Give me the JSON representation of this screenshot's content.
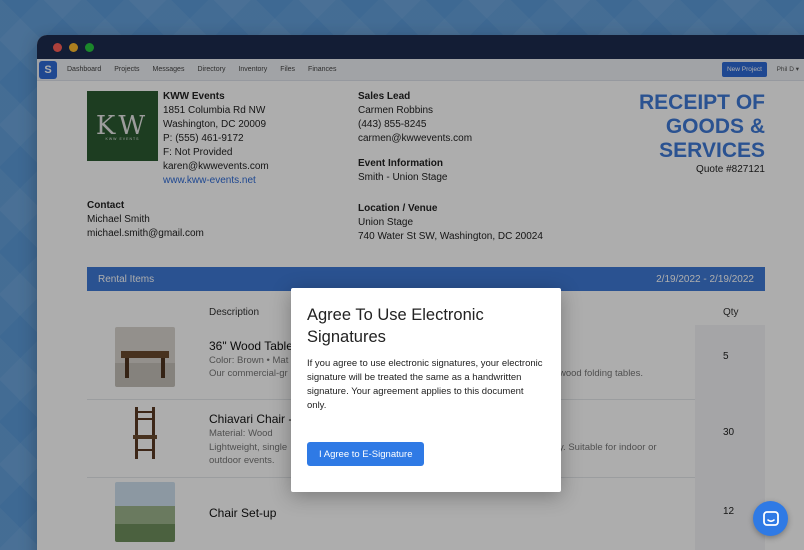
{
  "nav": {
    "logo_letter": "S",
    "items": [
      "Dashboard",
      "Projects",
      "Messages",
      "Directory",
      "Inventory",
      "Files",
      "Finances"
    ],
    "new_project": "New Project",
    "user": "Phil D ▾"
  },
  "company": {
    "logo_text": "KW",
    "logo_sub": "KWW EVENTS",
    "name": "KWW Events",
    "address1": "1851 Columbia Rd NW",
    "address2": "Washington, DC 20009",
    "phone": "P: (555) 461-9172",
    "fax": "F: Not Provided",
    "email": "karen@kwwevents.com",
    "website": "www.kww-events.net"
  },
  "contact": {
    "heading": "Contact",
    "name": "Michael Smith",
    "email": "michael.smith@gmail.com"
  },
  "sales_lead": {
    "heading": "Sales Lead",
    "name": "Carmen Robbins",
    "phone": "(443) 855-8245",
    "email": "carmen@kwwevents.com"
  },
  "event": {
    "heading": "Event Information",
    "name": "Smith - Union Stage"
  },
  "venue": {
    "heading": "Location / Venue",
    "name": "Union Stage",
    "address": "740 Water St SW, Washington, DC 20024"
  },
  "receipt": {
    "title_line1": "RECEIPT OF",
    "title_line2": "GOODS &",
    "title_line3": "SERVICES",
    "quote": "Quote #827121"
  },
  "rental": {
    "label": "Rental Items",
    "dates": "2/19/2022 - 2/19/2022",
    "col_description": "Description",
    "col_qty": "Qty",
    "items": [
      {
        "title": "36\" Wood Tables",
        "meta1": "Color: Brown • Mat",
        "meta2": "Our commercial-gr",
        "meta2_right": "wood folding tables.",
        "qty": "5"
      },
      {
        "title": "Chiavari Chair - N",
        "meta1": "Material: Wood",
        "meta2": "Lightweight, single",
        "meta2_right": "y. Suitable for indoor or",
        "meta3": "outdoor events.",
        "qty": "30"
      },
      {
        "title": "Chair Set-up",
        "qty": "12"
      }
    ]
  },
  "modal": {
    "title": "Agree To Use Electronic Signatures",
    "body": "If you agree to use electronic signatures, your electronic signature will be treated the same as a handwritten signature. Your agreement applies to this document only.",
    "button": "I Agree to E-Signature"
  },
  "colors": {
    "accent": "#3e79d6",
    "button": "#2f7ae5",
    "titlebar": "#1c2b4e",
    "logo_bg": "#2b5a31"
  }
}
